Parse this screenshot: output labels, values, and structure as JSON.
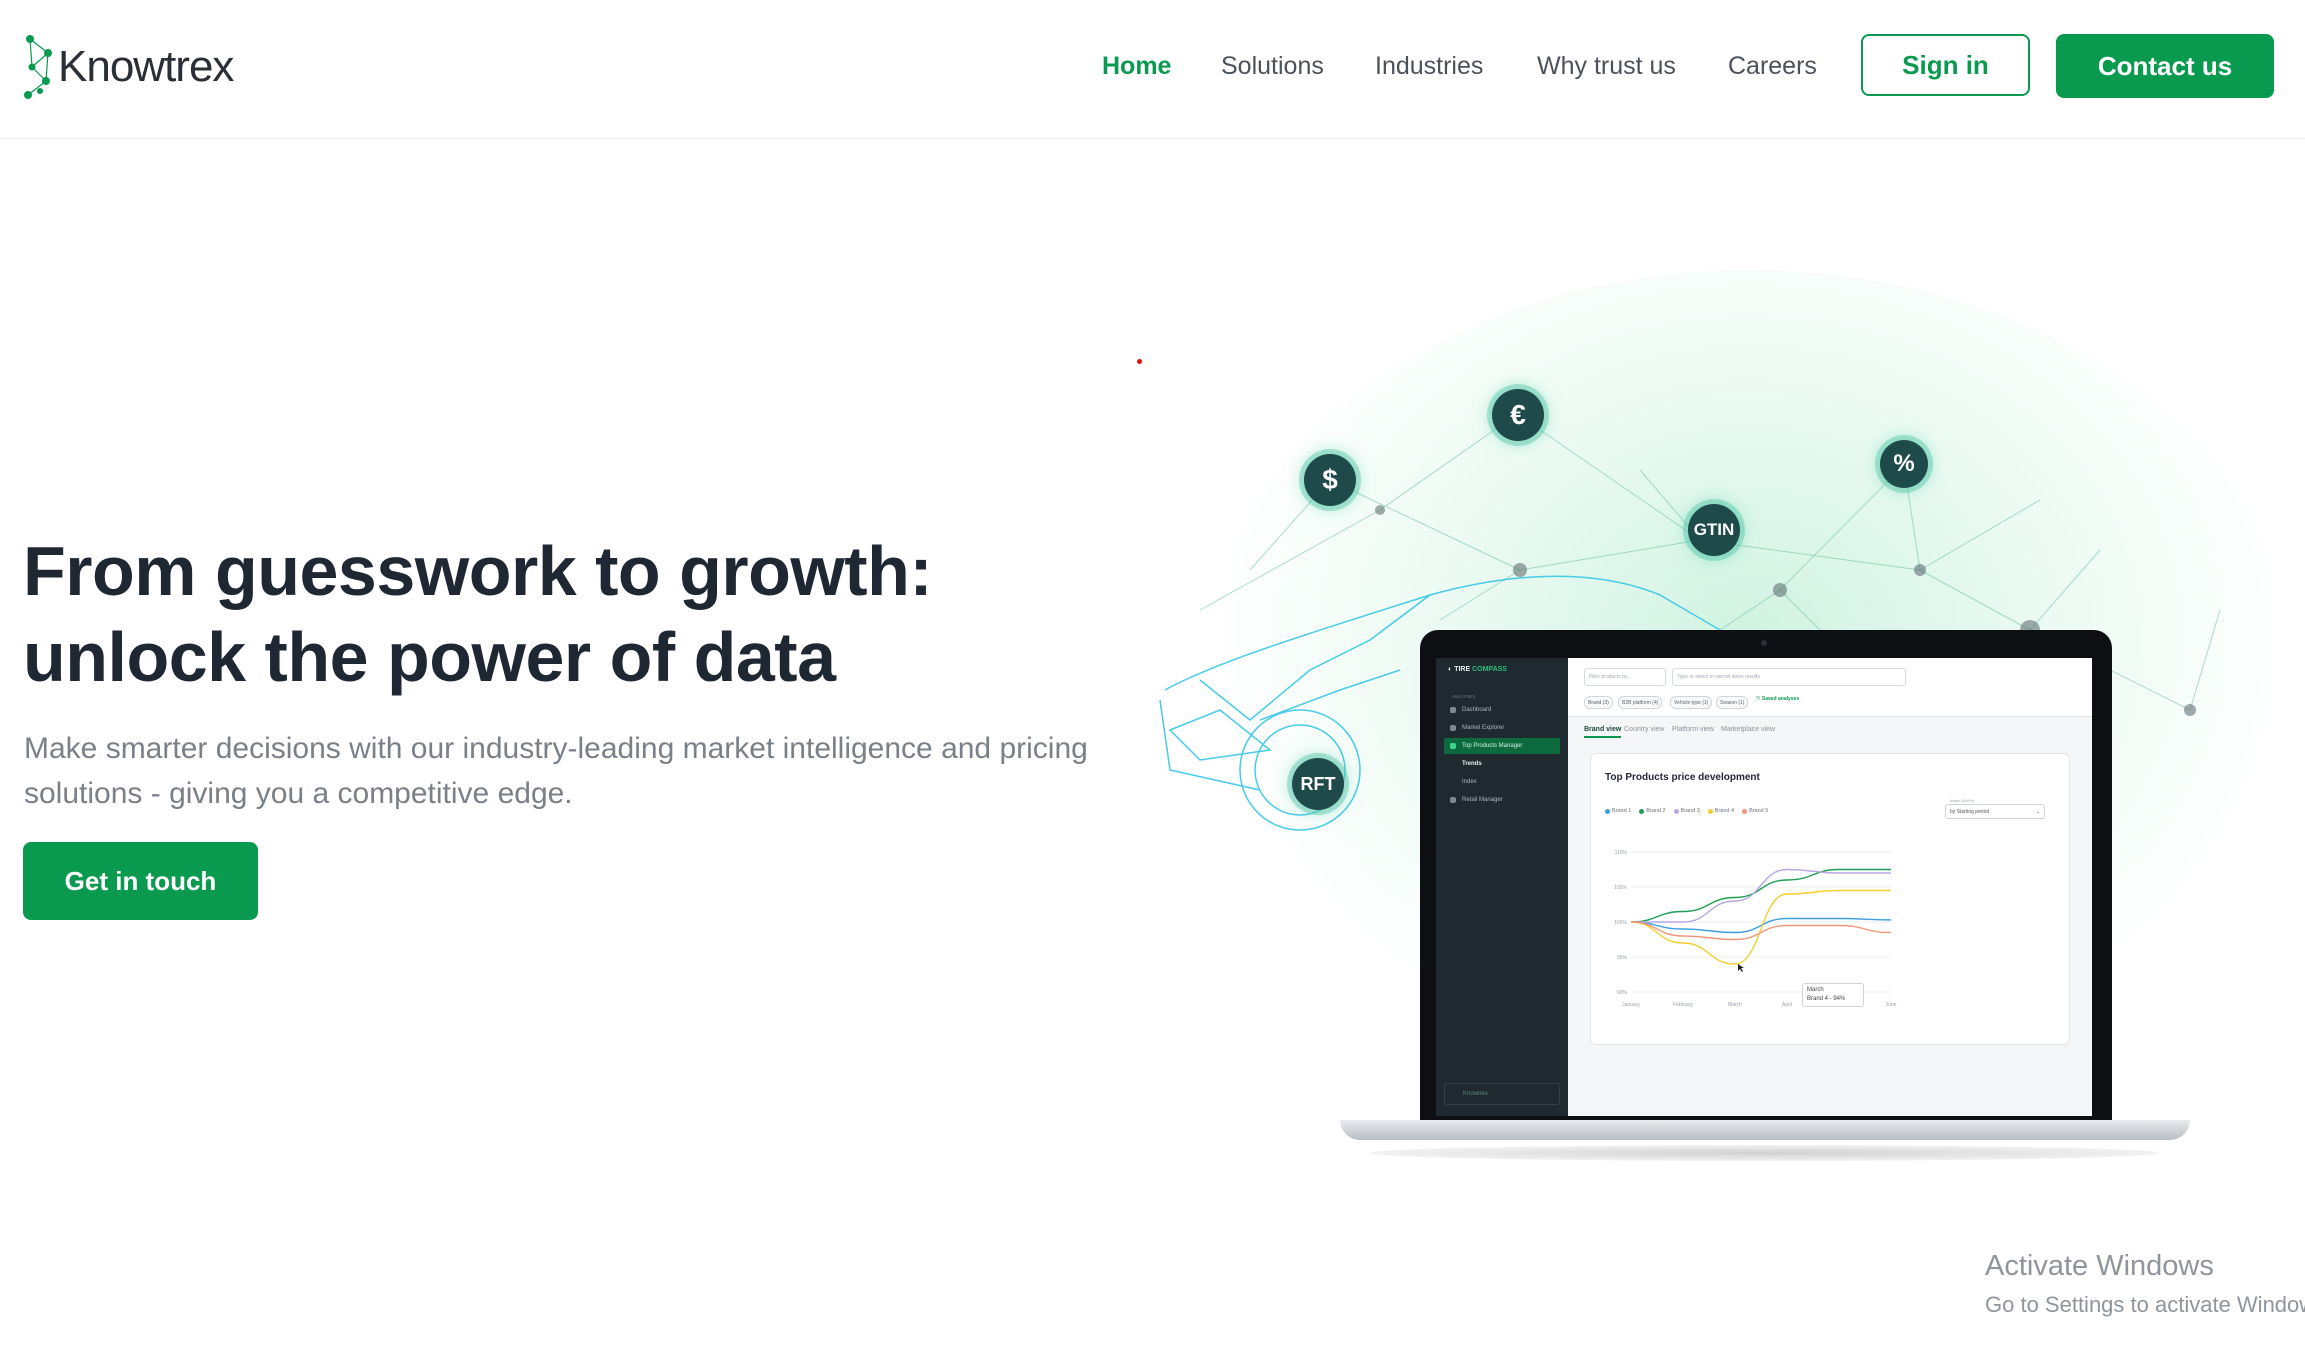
{
  "header": {
    "logo_text": "Knowtrex",
    "nav": [
      "Home",
      "Solutions",
      "Industries",
      "Why trust us",
      "Careers"
    ],
    "active_nav": "Home",
    "signin_label": "Sign in",
    "contact_label": "Contact us"
  },
  "hero": {
    "title_line1": "From guesswork to growth:",
    "title_line2": "unlock the power of data",
    "subtitle_line1": "Make smarter decisions with our industry-leading market intelligence and pricing",
    "subtitle_line2": "solutions - giving you a competitive edge.",
    "cta_label": "Get in touch"
  },
  "illustration": {
    "badges": [
      "$",
      "€",
      "%",
      "GTIN",
      "RFT"
    ],
    "app": {
      "brand": "TIRE",
      "brand_accent": "COMPASS",
      "sidebar_section": "ANALYSES",
      "sidebar_items": [
        "Dashboard",
        "Market Explorer",
        "Top Products Manager",
        "Trends",
        "Index",
        "Retail Manager"
      ],
      "sidebar_footer": "Knowtrex",
      "filter_placeholder": "Filter products by...",
      "search_placeholder": "Type or select to narrow down results",
      "chips": [
        "Brand (3)",
        "B2B platform (4)",
        "Vehicle type (1)",
        "Season (1)"
      ],
      "saved_label": "Saved analyses",
      "tabs": [
        "Brand view",
        "Country view",
        "Platform view",
        "Marketplace view"
      ],
      "card_title": "Top Products price development",
      "select_label": "Index (100%)",
      "select_value": "by Starting period",
      "tooltip_line1": "March",
      "tooltip_line2": "Brand 4 - 94%"
    }
  },
  "chart_data": {
    "type": "line",
    "title": "Top Products price development",
    "categories": [
      "January",
      "February",
      "March",
      "April",
      "May",
      "June"
    ],
    "y_ticks": [
      "110%",
      "105%",
      "100%",
      "95%",
      "90%"
    ],
    "ylim": [
      90,
      110
    ],
    "legend_position": "top-left",
    "series": [
      {
        "name": "Brand 1",
        "color": "#3a9fe0",
        "values": [
          100,
          99.0,
          98.5,
          100.5,
          100.5,
          100.3
        ]
      },
      {
        "name": "Brand 2",
        "color": "#1e9e52",
        "values": [
          100,
          101.5,
          103.5,
          106.0,
          107.5,
          107.5
        ]
      },
      {
        "name": "Brand 3",
        "color": "#b7a6e3",
        "values": [
          100,
          100.0,
          103.0,
          107.5,
          107.0,
          107.0
        ]
      },
      {
        "name": "Brand 4",
        "color": "#f2cf2c",
        "values": [
          100,
          97.0,
          94.0,
          104.0,
          104.5,
          104.5
        ]
      },
      {
        "name": "Brand 5",
        "color": "#f0967a",
        "values": [
          100,
          98.0,
          97.5,
          99.5,
          99.5,
          98.5
        ]
      }
    ]
  },
  "watermark": {
    "line1": "Activate Windows",
    "line2": "Go to Settings to activate Windows."
  },
  "colors": {
    "brand_green": "#0a9a4f",
    "heading": "#1f2733",
    "muted": "#7a8088"
  }
}
